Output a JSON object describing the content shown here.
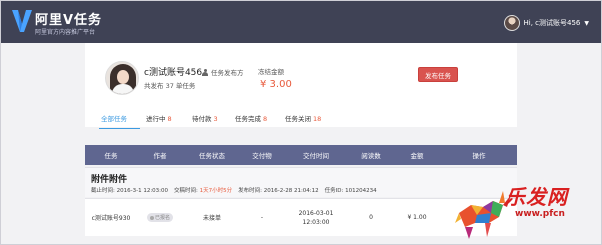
{
  "header": {
    "logo_title": "阿里V任务",
    "logo_subtitle": "阿里官方内容推广平台",
    "user_greeting": "Hi, c测试账号456"
  },
  "profile": {
    "name": "c测试账号456",
    "role": "任务发布方",
    "published": "共发布 37 单任务",
    "frozen_label": "冻结金额",
    "frozen_amount": "¥ 3.00",
    "publish_button": "发布任务"
  },
  "tabs": [
    {
      "label": "全部任务",
      "count": ""
    },
    {
      "label": "进行中",
      "count": "8"
    },
    {
      "label": "待付款",
      "count": "3"
    },
    {
      "label": "任务完成",
      "count": "8"
    },
    {
      "label": "任务关闭",
      "count": "18"
    }
  ],
  "table": {
    "columns": [
      "任务",
      "作者",
      "任务状态",
      "交付物",
      "交付时间",
      "阅读数",
      "金额",
      "操作"
    ]
  },
  "group": {
    "title": "附件附件",
    "deadline": "截止时间: 2016-3-1 12:03:00",
    "delivery_label": "交稿时间:",
    "delivery_value": "1天7小时5分",
    "publish_time": "发布时间: 2016-2-28 21:04:12",
    "task_id": "任务ID: 101204234"
  },
  "row": {
    "account": "c测试账号930",
    "author_badge": "已报名",
    "status": "未接单",
    "deliverable": "-",
    "delivery_date": "2016-03-01",
    "delivery_clock": "12:03:00",
    "reads": "0",
    "amount": "¥ 1.00",
    "action": ""
  },
  "watermark": {
    "text": "乐发网",
    "url": "www.pfcn"
  },
  "colors": {
    "header_bg": "#3f4255",
    "table_head_bg": "#5f6690",
    "accent_red": "#d9534f",
    "count_orange": "#e85a3c",
    "active_tab_blue": "#3b9ae1"
  }
}
